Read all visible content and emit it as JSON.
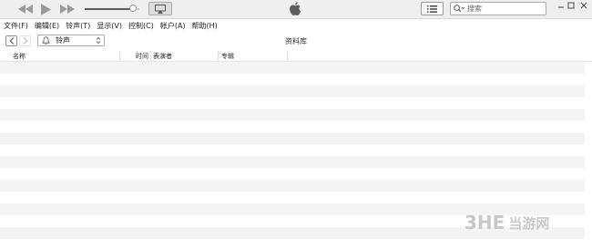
{
  "window": {
    "minimize_icon": "minimize-icon",
    "maximize_icon": "maximize-icon",
    "close_icon": "close-icon"
  },
  "player": {
    "volume_level": 0.88,
    "accent_color": "#5c5c5c"
  },
  "search": {
    "placeholder": "搜索"
  },
  "menu": {
    "items": [
      {
        "label": "文件(F)"
      },
      {
        "label": "编辑(E)"
      },
      {
        "label": "铃声(T)"
      },
      {
        "label": "显示(V)"
      },
      {
        "label": "控制(C)"
      },
      {
        "label": "帐户(A)"
      },
      {
        "label": "帮助(H)"
      }
    ]
  },
  "nav": {
    "media_type": "铃声",
    "library_title": "资料库"
  },
  "columns": {
    "name": "名称",
    "time": "时间",
    "artist": "表演者",
    "album": "专辑"
  },
  "song_list": {
    "rows": []
  },
  "watermark": {
    "brand": "3HE",
    "site": "当游网"
  }
}
